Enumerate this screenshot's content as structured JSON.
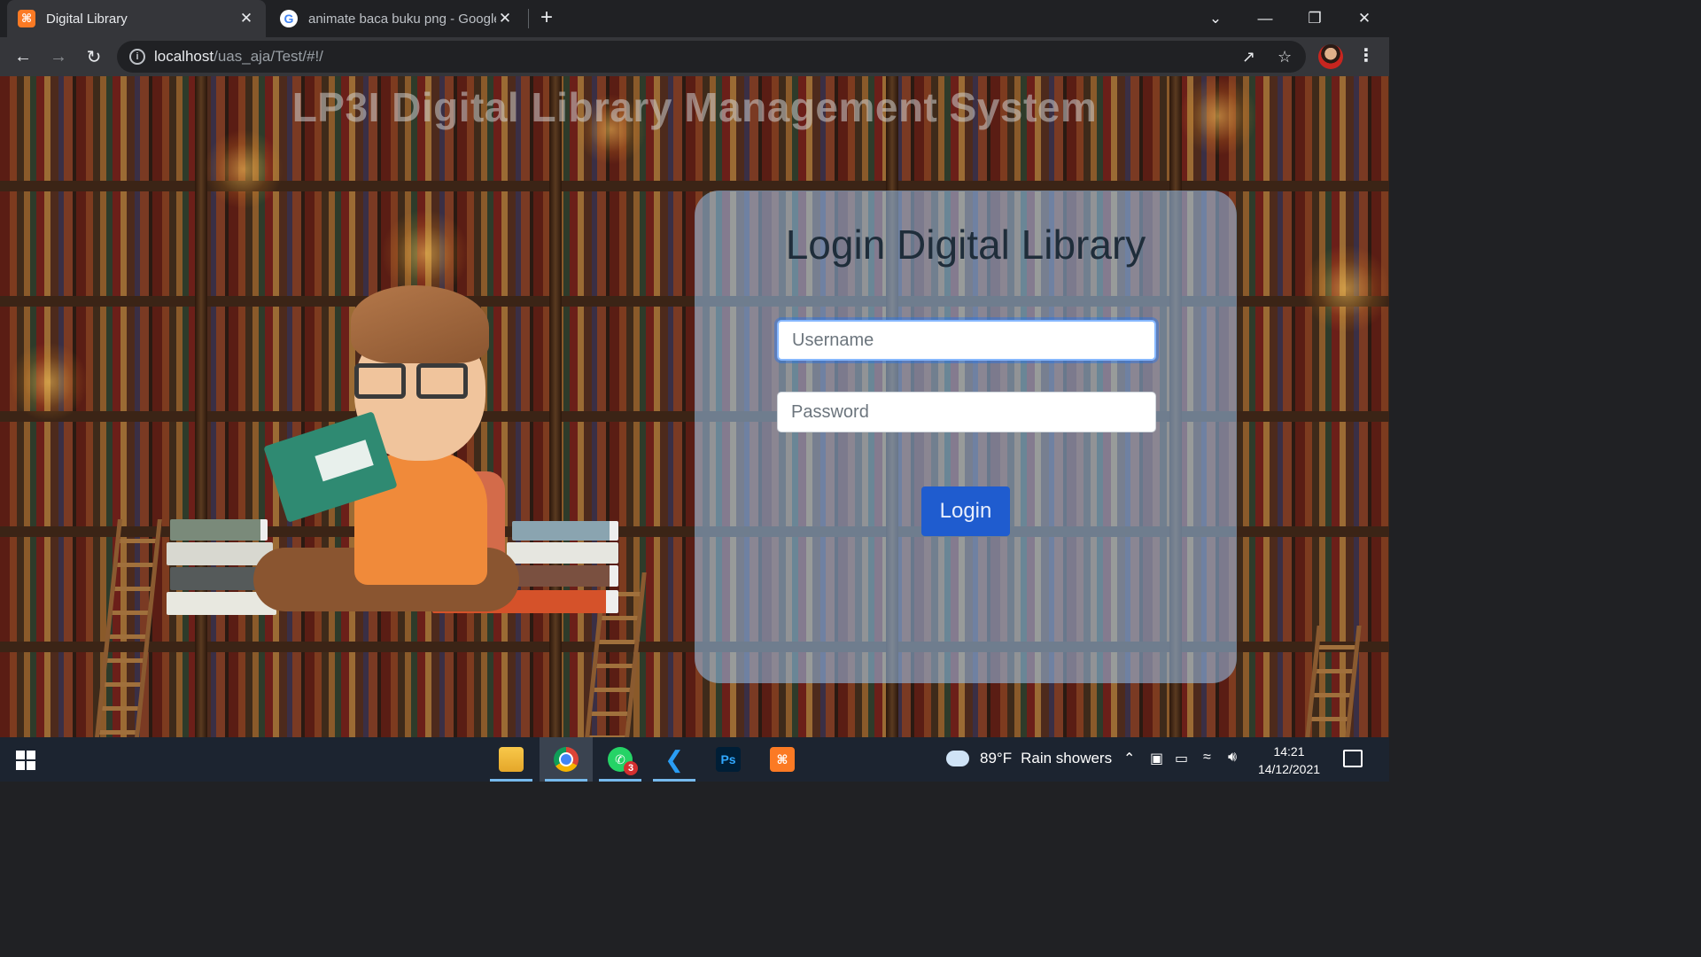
{
  "browser": {
    "tabs": [
      {
        "title": "Digital Library",
        "icon": "xampp-icon",
        "active": true
      },
      {
        "title": "animate baca buku png - Google",
        "icon": "google-icon",
        "active": false
      }
    ],
    "new_tab_symbol": "+",
    "url_host": "localhost",
    "url_path": "/uas_aja/Test/#!/"
  },
  "page": {
    "site_title": "LP3I Digital Library Management System",
    "login": {
      "title": "Login Digital Library",
      "username_placeholder": "Username",
      "password_placeholder": "Password",
      "button_label": "Login"
    }
  },
  "taskbar": {
    "apps": [
      "file-explorer-icon",
      "chrome-icon",
      "whatsapp-icon",
      "vscode-icon",
      "photoshop-icon",
      "xampp-icon"
    ],
    "whatsapp_badge": "3",
    "photoshop_label": "Ps",
    "weather_temp": "89°F",
    "weather_desc": "Rain showers",
    "time": "14:21",
    "date": "14/12/2021"
  },
  "colors": {
    "login_button": "#1f5ccf",
    "card": "#96bee6"
  }
}
